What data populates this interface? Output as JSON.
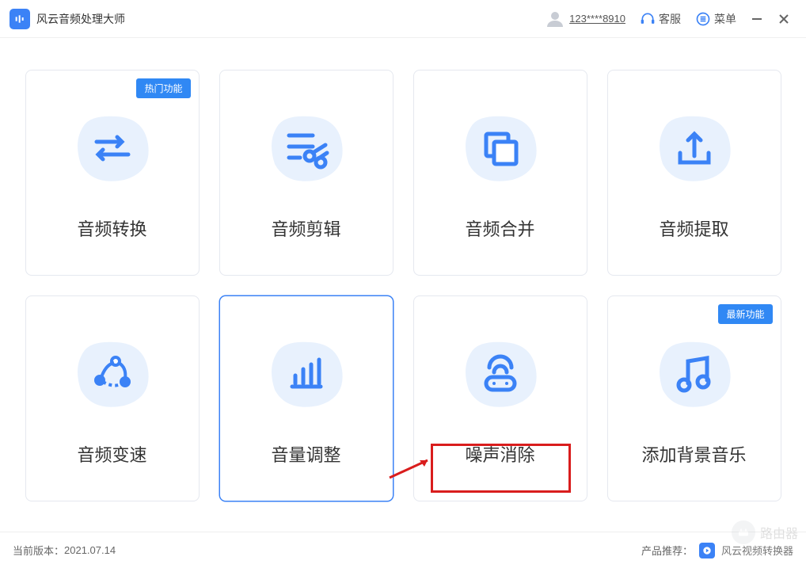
{
  "app": {
    "title": "风云音频处理大师"
  },
  "header": {
    "user_id": "123****8910",
    "support_label": "客服",
    "menu_label": "菜单"
  },
  "cards": [
    {
      "label": "音频转换",
      "badge": "热门功能",
      "icon": "convert-icon"
    },
    {
      "label": "音频剪辑",
      "badge": null,
      "icon": "trim-icon"
    },
    {
      "label": "音频合并",
      "badge": null,
      "icon": "merge-icon"
    },
    {
      "label": "音频提取",
      "badge": null,
      "icon": "extract-icon"
    },
    {
      "label": "音频变速",
      "badge": null,
      "icon": "speed-icon"
    },
    {
      "label": "音量调整",
      "badge": null,
      "icon": "volume-icon",
      "hover": true
    },
    {
      "label": "噪声消除",
      "badge": null,
      "icon": "denoise-icon",
      "highlighted": true
    },
    {
      "label": "添加背景音乐",
      "badge": "最新功能",
      "icon": "bgm-icon"
    }
  ],
  "footer": {
    "version_label": "当前版本：",
    "version": "2021.07.14",
    "recommend_label": "产品推荐：",
    "recommend_app": "风云视频转换器"
  },
  "watermark": {
    "text": "路由器"
  }
}
